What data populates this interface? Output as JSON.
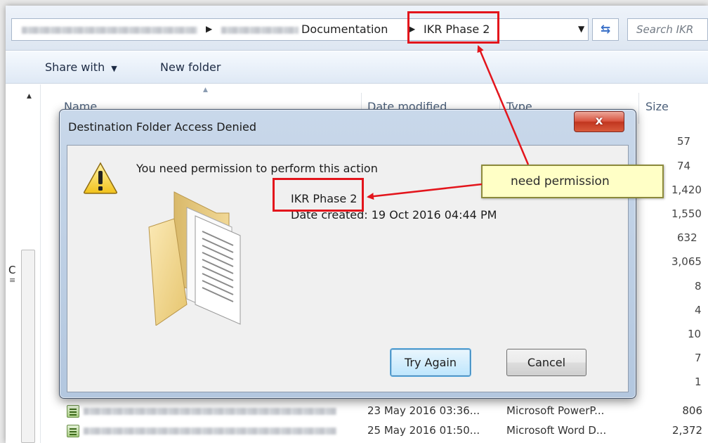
{
  "address_bar": {
    "breadcrumb_current_parent": "Documentation",
    "breadcrumb_current": "IKR Phase 2",
    "search_placeholder": "Search IKR"
  },
  "toolbar": {
    "share_with_label": "Share with",
    "share_with_arrow": "▼",
    "new_folder_label": "New folder"
  },
  "columns": {
    "name": "Name",
    "date_modified": "Date modified",
    "type": "Type",
    "size": "Size"
  },
  "nav_pane": {
    "partial_letter": "C"
  },
  "size_column_values": [
    "57",
    "74",
    "1,420",
    "1,550",
    "632",
    "3,065",
    "8",
    "4",
    "10",
    "7",
    "1"
  ],
  "file_rows": [
    {
      "date": "23 May 2016 03:36...",
      "type": "Microsoft PowerP...",
      "size": "806"
    },
    {
      "date": "25 May 2016 01:50...",
      "type": "Microsoft Word D...",
      "size": "2,372"
    }
  ],
  "dialog": {
    "title": "Destination Folder Access Denied",
    "message": "You need permission to perform this action",
    "folder_name": "IKR Phase 2",
    "date_created": "Date created: 19 Oct 2016 04:44 PM",
    "try_again_label": "Try Again",
    "cancel_label": "Cancel",
    "close_glyph": "x"
  },
  "annotation": {
    "callout_text": "need permission",
    "highlight_color": "#e3151c"
  },
  "icons": [
    "warning-icon",
    "folder-icon",
    "refresh-icon",
    "chevron-down-icon",
    "sort-ascending-icon",
    "file-icon"
  ]
}
